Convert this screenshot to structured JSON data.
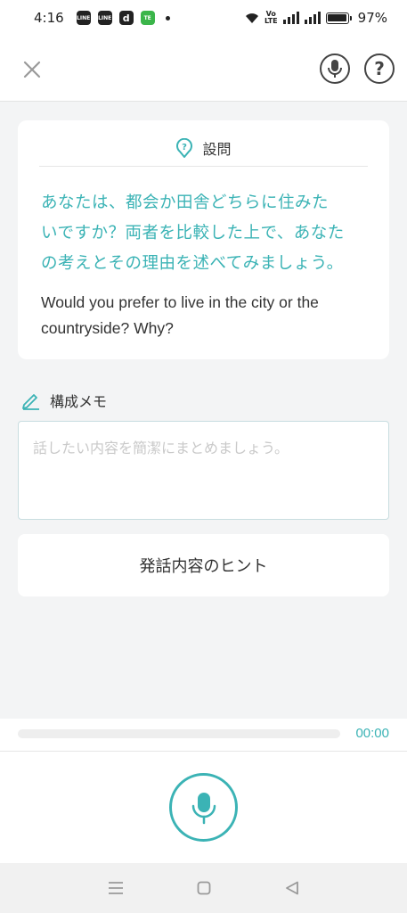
{
  "status_bar": {
    "time": "4:16",
    "battery_percent": "97%",
    "volte": "VoLTE",
    "app_icons": [
      "LINE",
      "LINE",
      "d",
      "TE"
    ]
  },
  "header": {
    "close_icon": "close-icon",
    "mic_icon": "microphone-icon",
    "help_icon": "help-icon"
  },
  "question": {
    "heading": "設問",
    "japanese_lines": [
      "あなたは、都会か田舎どちらに住みた",
      "いですか？両者を比較した上で、あなた",
      "の考えとその理由を述べてみましょう。"
    ],
    "english_lines": [
      "Would you prefer to live in the city or the",
      "countryside? Why?"
    ]
  },
  "memo": {
    "label": "構成メモ",
    "value": "",
    "placeholder": "話したい内容を簡潔にまとめましょう。"
  },
  "hint_button": {
    "label": "発話内容のヒント"
  },
  "recording": {
    "timer": "00:00",
    "progress": 0
  },
  "colors": {
    "accent": "#3bb3b5",
    "background": "#f3f4f5",
    "text": "#333333"
  }
}
